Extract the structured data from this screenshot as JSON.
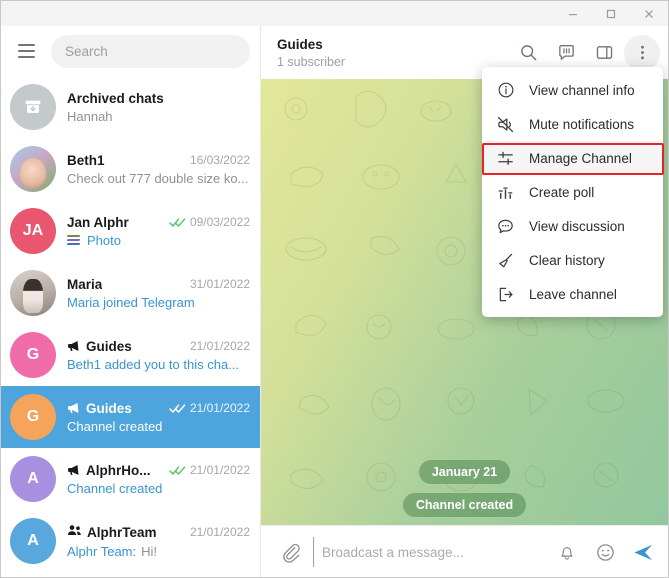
{
  "window": {
    "minimize_label": "Minimize",
    "maximize_label": "Maximize",
    "close_label": "Close"
  },
  "sidebar": {
    "menu_icon": "hamburger-icon",
    "search": {
      "placeholder": "Search",
      "value": ""
    },
    "chats": [
      {
        "name": "Archived chats",
        "preview": "Hannah",
        "date": "",
        "avatar_type": "archive",
        "avatar_color": "#c4c9cc",
        "avatar_letter": "",
        "badge": "",
        "selected": false,
        "preview_blue": false,
        "ticks": false,
        "icon": ""
      },
      {
        "name": "Beth1",
        "preview": "Check out 777 double size ko...",
        "date": "16/03/2022",
        "avatar_type": "photo-beth",
        "avatar_color": "",
        "avatar_letter": "",
        "selected": false,
        "preview_blue": false,
        "ticks": false,
        "icon": ""
      },
      {
        "name": "Jan Alphr",
        "preview": "Photo",
        "date": "09/03/2022",
        "avatar_type": "letter",
        "avatar_color": "#e8566f",
        "avatar_letter": "JA",
        "selected": false,
        "preview_blue": true,
        "ticks": true,
        "icon": "photo-thumb-icon"
      },
      {
        "name": "Maria",
        "preview": "Maria joined Telegram",
        "date": "31/01/2022",
        "avatar_type": "photo-maria",
        "avatar_color": "",
        "avatar_letter": "",
        "selected": false,
        "preview_blue": true,
        "ticks": false,
        "icon": ""
      },
      {
        "name": "Guides",
        "preview": "Beth1 added you to this cha...",
        "date": "21/01/2022",
        "avatar_type": "letter",
        "avatar_color": "#ef6ca8",
        "avatar_letter": "G",
        "selected": false,
        "preview_blue": true,
        "ticks": false,
        "icon": "broadcast-icon"
      },
      {
        "name": "Guides",
        "preview": "Channel created",
        "date": "21/01/2022",
        "avatar_type": "letter",
        "avatar_color": "#f6a45c",
        "avatar_letter": "G",
        "selected": true,
        "preview_blue": true,
        "ticks": true,
        "icon": "broadcast-icon"
      },
      {
        "name": "AlphrHo...",
        "preview": "Channel created",
        "date": "21/01/2022",
        "avatar_type": "letter",
        "avatar_color": "#a98fe0",
        "avatar_letter": "A",
        "selected": false,
        "preview_blue": true,
        "ticks": true,
        "icon": "broadcast-icon"
      },
      {
        "name": "AlphrTeam",
        "preview": "Alphr Team: Hi!",
        "preview_prefix": "Alphr Team:",
        "preview_rest": "Hi!",
        "date": "21/01/2022",
        "avatar_type": "letter",
        "avatar_color": "#58a8dd",
        "avatar_letter": "A",
        "selected": false,
        "preview_blue": true,
        "ticks": false,
        "icon": "group-icon"
      }
    ]
  },
  "chat_header": {
    "title": "Guides",
    "subtitle": "1 subscriber",
    "actions": [
      {
        "name": "search-icon",
        "label": "Search"
      },
      {
        "name": "discussion-icon",
        "label": "Discussion"
      },
      {
        "name": "panel-icon",
        "label": "Info panel"
      },
      {
        "name": "more-icon",
        "label": "More"
      }
    ]
  },
  "conversation": {
    "date_pill": "January 21",
    "service_message": "Channel created"
  },
  "composer": {
    "attach_icon": "paperclip-icon",
    "placeholder": "Broadcast a message...",
    "value": "",
    "bell_icon": "bell-icon",
    "emoji_icon": "emoji-icon",
    "send_icon": "send-icon"
  },
  "context_menu": {
    "items": [
      {
        "label": "View channel info",
        "icon": "info-icon",
        "highlighted": false
      },
      {
        "label": "Mute notifications",
        "icon": "mute-icon",
        "highlighted": false
      },
      {
        "label": "Manage Channel",
        "icon": "sliders-icon",
        "highlighted": true
      },
      {
        "label": "Create poll",
        "icon": "poll-icon",
        "highlighted": false
      },
      {
        "label": "View discussion",
        "icon": "comment-icon",
        "highlighted": false
      },
      {
        "label": "Clear history",
        "icon": "broom-icon",
        "highlighted": false
      },
      {
        "label": "Leave channel",
        "icon": "exit-icon",
        "highlighted": false
      }
    ]
  },
  "annotation": {
    "highlight_color": "#e8222a",
    "target_label": "Manage Channel"
  },
  "colors": {
    "accent": "#4ea4dd",
    "link": "#3a93d3",
    "tick": "#5cc46a",
    "send": "#3a93d3"
  }
}
